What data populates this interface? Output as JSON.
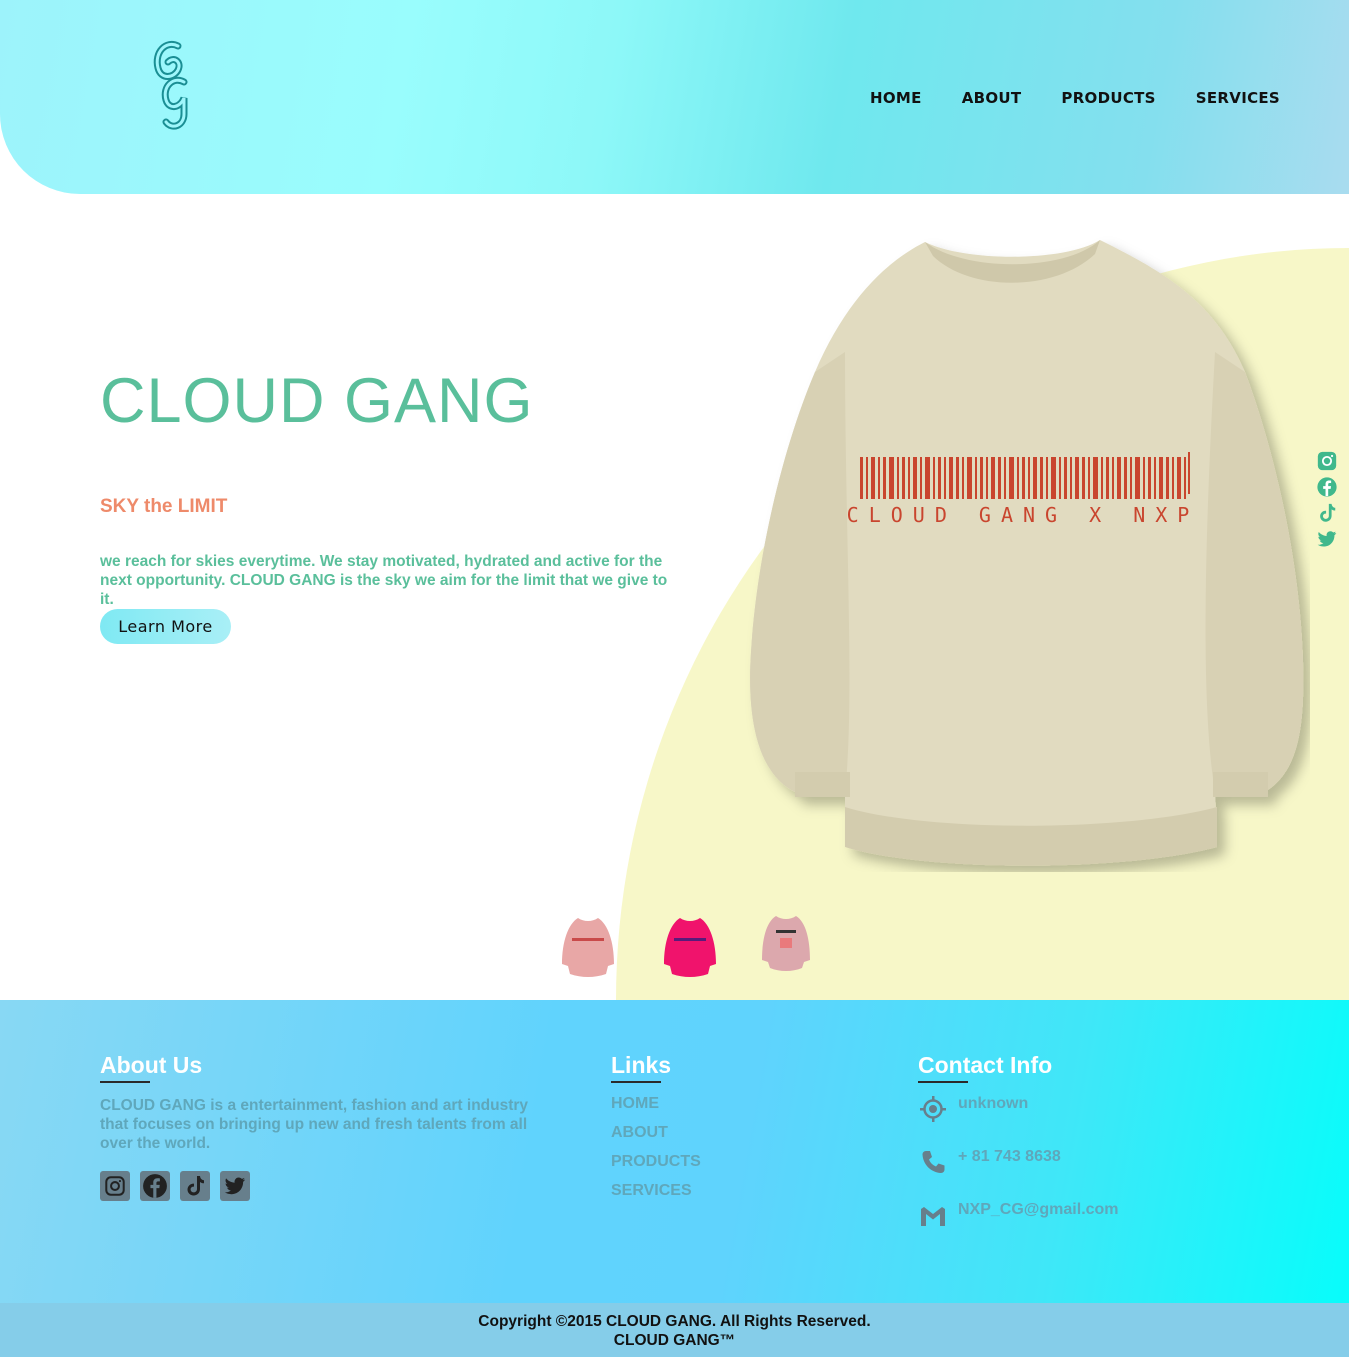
{
  "header": {
    "logo_alt": "CG",
    "nav": [
      "HOME",
      "ABOUT",
      "PRODUCTS",
      "SERVICES"
    ]
  },
  "hero": {
    "title": "CLOUD GANG",
    "subtitle": "SKY the LIMIT",
    "description": "we reach for skies everytime. We stay motivated, hydrated and active for the next opportunity. CLOUD GANG is the sky we aim for the limit that we give to it.",
    "button_label": "Learn More",
    "product_print": "CLOUD GANG X NXP",
    "thumbnails": [
      "light-pink-sweater",
      "hot-pink-sweater",
      "pink-sweater"
    ]
  },
  "side_social": [
    "instagram-icon",
    "facebook-icon",
    "tiktok-icon",
    "twitter-icon"
  ],
  "footer": {
    "about": {
      "heading": "About Us",
      "text": "CLOUD GANG is a entertainment, fashion and art industry that focuses on bringing up new and fresh talents from all over the world."
    },
    "links": {
      "heading": "Links",
      "items": [
        "HOME",
        "ABOUT",
        "PRODUCTS",
        "SERVICES"
      ]
    },
    "contact": {
      "heading": "Contact Info",
      "location": "unknown",
      "phone": "+ 81 743 8638",
      "email": "NXP_CG@gmail.com"
    },
    "copyright_line1": "Copyright ©2015 CLOUD GANG. All Rights Reserved.",
    "copyright_line2": "CLOUD GANG™"
  },
  "colors": {
    "accent_green": "#5abf9b",
    "accent_coral": "#ee8a6a",
    "footer_text": "#5fa7bb"
  }
}
